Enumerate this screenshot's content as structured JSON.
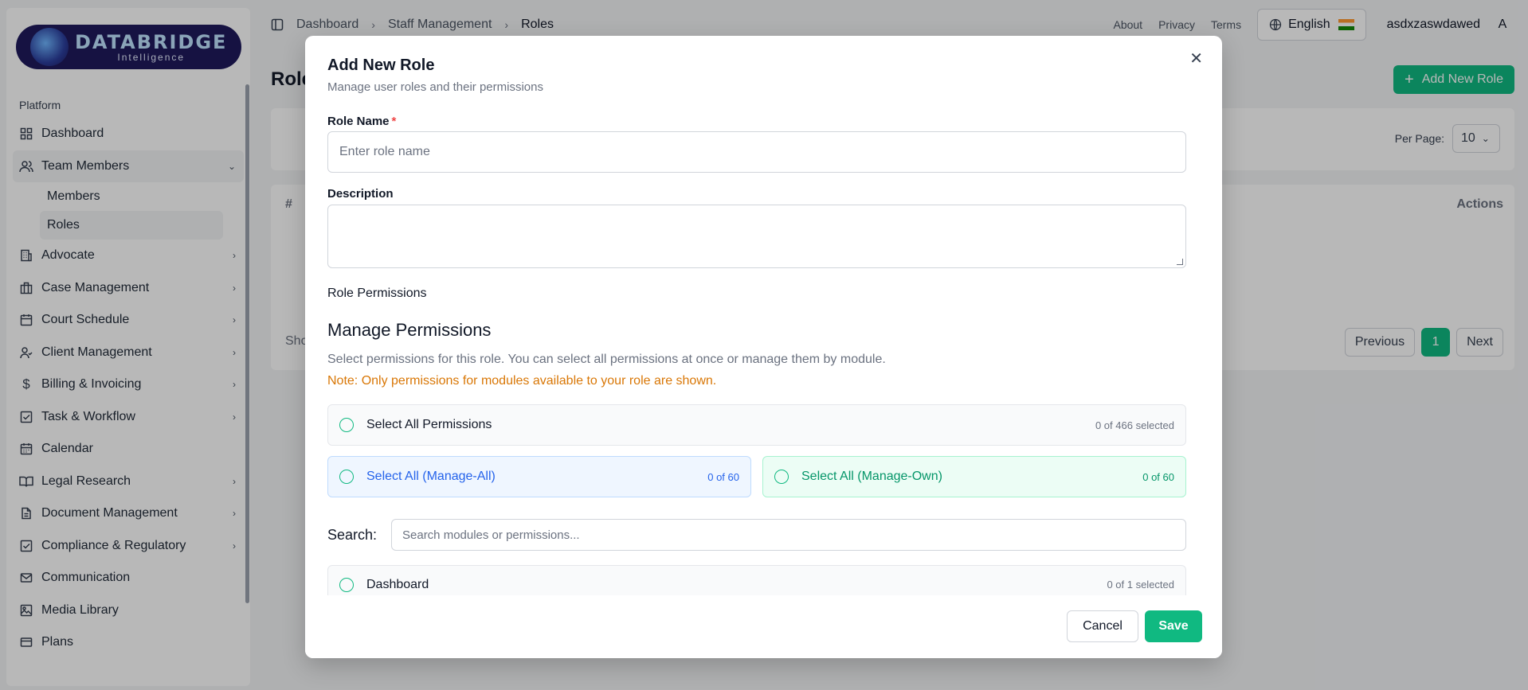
{
  "brand": {
    "title": "DATABRIDGE",
    "subtitle": "Intelligence"
  },
  "sidebar": {
    "section": "Platform",
    "items": [
      {
        "label": "Dashboard",
        "icon": "dashboard-icon"
      },
      {
        "label": "Team Members",
        "icon": "users-icon",
        "expanded": true,
        "children": [
          "Members",
          "Roles"
        ]
      },
      {
        "label": "Advocate",
        "icon": "building-icon"
      },
      {
        "label": "Case Management",
        "icon": "briefcase-icon"
      },
      {
        "label": "Court Schedule",
        "icon": "calendar-icon"
      },
      {
        "label": "Client Management",
        "icon": "user-check-icon"
      },
      {
        "label": "Billing & Invoicing",
        "icon": "dollar-icon"
      },
      {
        "label": "Task & Workflow",
        "icon": "check-square-icon"
      },
      {
        "label": "Calendar",
        "icon": "calendar-icon"
      },
      {
        "label": "Legal Research",
        "icon": "book-icon"
      },
      {
        "label": "Document Management",
        "icon": "file-icon"
      },
      {
        "label": "Compliance & Regulatory",
        "icon": "check-square-icon"
      },
      {
        "label": "Communication",
        "icon": "mail-icon"
      },
      {
        "label": "Media Library",
        "icon": "image-icon"
      },
      {
        "label": "Plans",
        "icon": "credit-card-icon"
      }
    ],
    "sub": {
      "members": "Members",
      "roles": "Roles"
    }
  },
  "topbar": {
    "breadcrumb": [
      "Dashboard",
      "Staff Management",
      "Roles"
    ],
    "links": [
      "About",
      "Privacy",
      "Terms"
    ],
    "language": "English",
    "username": "asdxzaswdawed",
    "avatar_initial": "A"
  },
  "page": {
    "title": "Roles",
    "add_button": "Add New Role",
    "per_page_label": "Per Page:",
    "per_page_value": "10",
    "col_hash": "#",
    "col_actions": "Actions",
    "showing_prefix": "Sho",
    "pager": {
      "prev": "Previous",
      "current": "1",
      "next": "Next"
    }
  },
  "modal": {
    "title": "Add New Role",
    "subtitle": "Manage user roles and their permissions",
    "role_name_label": "Role Name",
    "required_mark": "*",
    "role_name_placeholder": "Enter role name",
    "description_label": "Description",
    "role_permissions_label": "Role Permissions",
    "manage_title": "Manage Permissions",
    "manage_desc": "Select permissions for this role. You can select all permissions at once or manage them by module.",
    "note": "Note: Only permissions for modules available to your role are shown.",
    "select_all": {
      "label": "Select All Permissions",
      "count": "0 of 466 selected"
    },
    "manage_all": {
      "label": "Select All (Manage-All)",
      "count": "0 of 60"
    },
    "manage_own": {
      "label": "Select All (Manage-Own)",
      "count": "0 of 60"
    },
    "search_label": "Search:",
    "search_placeholder": "Search modules or permissions...",
    "module_row": {
      "label": "Dashboard",
      "count": "0 of 1 selected"
    },
    "cancel": "Cancel",
    "save": "Save"
  },
  "colors": {
    "accent": "#10b981",
    "brand": "#1f1a5c",
    "note": "#d97706"
  }
}
